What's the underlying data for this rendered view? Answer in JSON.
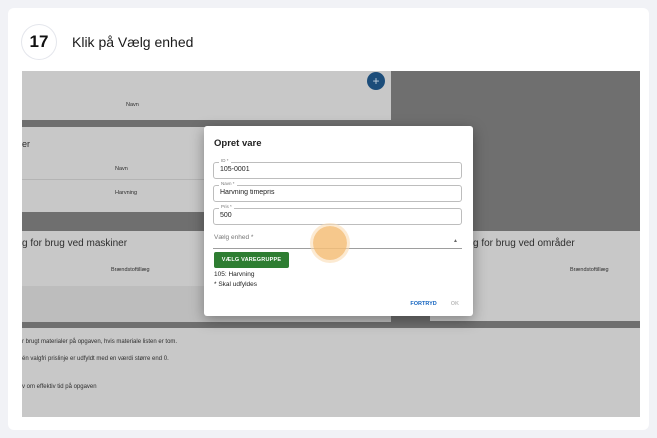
{
  "step": {
    "number": "17",
    "title": "Klik på Vælg enhed"
  },
  "background": {
    "table1_header": "Navn",
    "section2_title_fragment": "er",
    "table2_header": "Navn",
    "table2_row": "Harvning",
    "section3_title": "g for brug ved maskiner",
    "section3_column": "Brændstoftillæg",
    "section4_title": "g for brug ved områder",
    "section4_column": "Brændstoftillæg",
    "notes": [
      "r brugt materialer på opgaven, hvis materiale listen er tom.",
      "én valgfri prislinje er udfyldt med en værdi større end 0.",
      "v om effektiv tid på opgaven"
    ],
    "fab_symbol": "+"
  },
  "dialog": {
    "title": "Opret vare",
    "fields": [
      {
        "label": "ID *",
        "value": "105-0001"
      },
      {
        "label": "Navn *",
        "value": "Harvning timepris"
      },
      {
        "label": "Pris *",
        "value": "500"
      }
    ],
    "select_placeholder": "Vælg enhed *",
    "select_caret": "▲",
    "varegruppe_button": "VÆLG VAREGRUPPE",
    "selected_group": "105: Harvning",
    "required_note": "* Skal udfyldes",
    "cancel_button": "FORTRYD",
    "ok_button": "OK"
  }
}
